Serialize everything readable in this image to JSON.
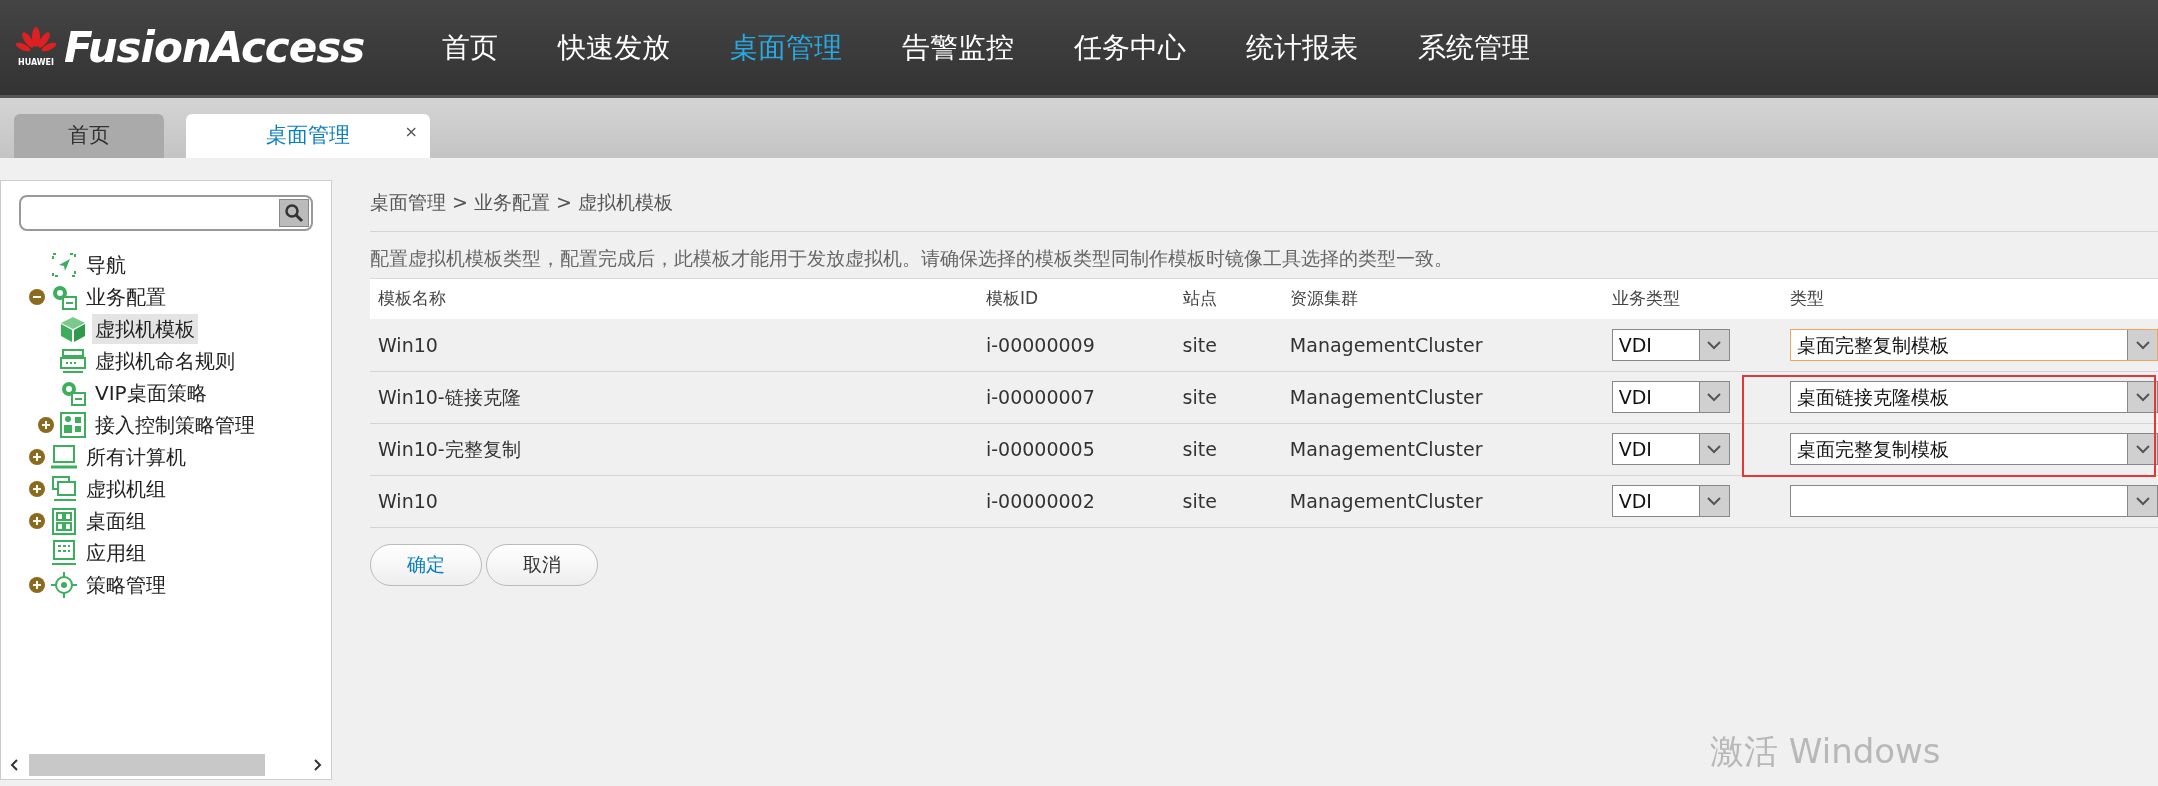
{
  "header": {
    "logo_text": "FusionAccess",
    "brand_text": "HUAWEI",
    "nav": [
      {
        "label": "首页",
        "selected": false
      },
      {
        "label": "快速发放",
        "selected": false
      },
      {
        "label": "桌面管理",
        "selected": true
      },
      {
        "label": "告警监控",
        "selected": false
      },
      {
        "label": "任务中心",
        "selected": false
      },
      {
        "label": "统计报表",
        "selected": false
      },
      {
        "label": "系统管理",
        "selected": false
      }
    ]
  },
  "tabs": [
    {
      "label": "首页",
      "selected": false,
      "closable": false
    },
    {
      "label": "桌面管理",
      "selected": true,
      "closable": true,
      "close_glyph": "×"
    }
  ],
  "sidebar": {
    "tree": [
      {
        "label": "导航",
        "kind": "nav",
        "selected": false
      },
      {
        "label": "业务配置",
        "kind": "gear",
        "selected": false,
        "expanded": true,
        "children": [
          {
            "label": "虚拟机模板",
            "kind": "cube",
            "selected": true
          },
          {
            "label": "虚拟机命名规则",
            "kind": "server",
            "selected": false
          },
          {
            "label": "VIP桌面策略",
            "kind": "gear",
            "selected": false
          },
          {
            "label": "接入控制策略管理",
            "kind": "access",
            "selected": false,
            "expanded": false
          }
        ]
      },
      {
        "label": "所有计算机",
        "kind": "computer",
        "selected": false,
        "expanded": false
      },
      {
        "label": "虚拟机组",
        "kind": "vmgroup",
        "selected": false,
        "expanded": false
      },
      {
        "label": "桌面组",
        "kind": "grid",
        "selected": false,
        "expanded": false
      },
      {
        "label": "应用组",
        "kind": "appgroup",
        "selected": false
      },
      {
        "label": "策略管理",
        "kind": "policy",
        "selected": false,
        "expanded": false
      }
    ]
  },
  "content": {
    "breadcrumb": [
      "桌面管理",
      "业务配置",
      "虚拟机模板"
    ],
    "breadcrumb_separator": ">",
    "description": "配置虚拟机模板类型，配置完成后，此模板才能用于发放虚拟机。请确保选择的模板类型同制作模板时镜像工具选择的类型一致。",
    "table": {
      "columns": [
        "模板名称",
        "模板ID",
        "站点",
        "资源集群",
        "业务类型",
        "类型"
      ],
      "rows": [
        {
          "name": "Win10",
          "id": "i-00000009",
          "site": "site",
          "cluster": "ManagementCluster",
          "service_type": "VDI",
          "type": "桌面完整复制模板",
          "focused": true,
          "highlighted": false
        },
        {
          "name": "Win10-链接克隆",
          "id": "i-00000007",
          "site": "site",
          "cluster": "ManagementCluster",
          "service_type": "VDI",
          "type": "桌面链接克隆模板",
          "focused": false,
          "highlighted": true
        },
        {
          "name": "Win10-完整复制",
          "id": "i-00000005",
          "site": "site",
          "cluster": "ManagementCluster",
          "service_type": "VDI",
          "type": "桌面完整复制模板",
          "focused": false,
          "highlighted": true
        },
        {
          "name": "Win10",
          "id": "i-00000002",
          "site": "site",
          "cluster": "ManagementCluster",
          "service_type": "VDI",
          "focused": false,
          "highlighted": false
        }
      ]
    },
    "buttons": [
      {
        "label": "确定",
        "kind": "primary"
      },
      {
        "label": "取消",
        "kind": "secondary"
      }
    ]
  },
  "os_notice": "激活 Windows"
}
